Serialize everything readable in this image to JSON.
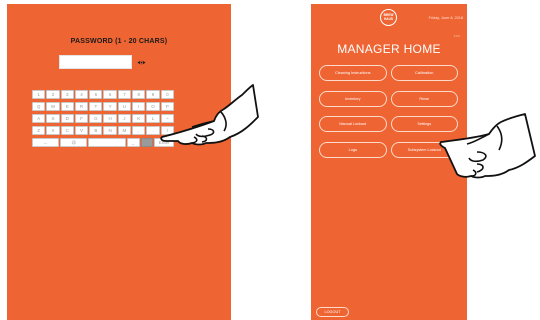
{
  "password_screen": {
    "title": "PASSWORD (1 - 20 CHARS)",
    "password_value": "",
    "keyboard": {
      "rows": [
        [
          "1",
          "2",
          "3",
          "4",
          "5",
          "6",
          "7",
          "8",
          "9",
          "0"
        ],
        [
          "Q",
          "W",
          "E",
          "R",
          "T",
          "Y",
          "U",
          "I",
          "O",
          "P"
        ],
        [
          "A",
          "S",
          "D",
          "F",
          "G",
          "H",
          "J",
          "K",
          "L",
          "~"
        ],
        [
          "Z",
          "X",
          "C",
          "V",
          "B",
          "N",
          "M",
          ",",
          ".",
          "/"
        ]
      ],
      "bottom_row": {
        "backspace": "←",
        "at": "@",
        "space": "",
        "dot": "_",
        "shift": "",
        "enter": "Enter"
      }
    }
  },
  "manager_screen": {
    "logo_text": "BREW HAUS",
    "date": "Friday, June 8, 2018",
    "small_label": "0.0.0",
    "title": "MANAGER HOME",
    "menu_items": [
      "Cleaning Instructions",
      "Calibration",
      "Inventory",
      "Rinse",
      "Manual Lockout",
      "Settings",
      "Logs",
      "Subsystem Lockout"
    ],
    "logout_label": "LOGOUT"
  },
  "colors": {
    "screen_background": "#ef6433",
    "text_dark": "#1a1a1a",
    "white": "#ffffff"
  },
  "icons": [
    "eye-icon",
    "pointing-hand-icon"
  ]
}
